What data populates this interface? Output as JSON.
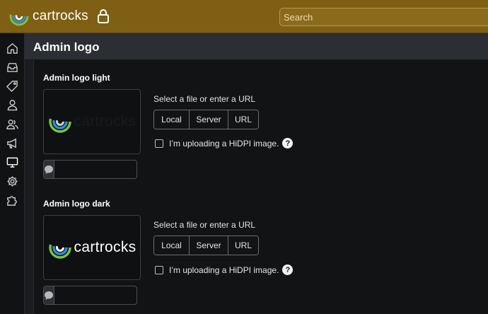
{
  "topbar": {
    "brand_name": "cartrocks",
    "lock_icon": "lock-icon",
    "search_placeholder": "Search"
  },
  "sidebar": {
    "items": [
      {
        "name": "home",
        "icon": "home-icon"
      },
      {
        "name": "inbox",
        "icon": "inbox-icon"
      },
      {
        "name": "tags",
        "icon": "tag-icon"
      },
      {
        "name": "user",
        "icon": "user-icon"
      },
      {
        "name": "users",
        "icon": "users-icon"
      },
      {
        "name": "announcements",
        "icon": "megaphone-icon"
      },
      {
        "name": "appearance",
        "icon": "monitor-icon",
        "active": true
      },
      {
        "name": "settings",
        "icon": "gear-icon"
      },
      {
        "name": "plugins",
        "icon": "puzzle-icon"
      }
    ]
  },
  "page": {
    "title": "Admin logo"
  },
  "sections": [
    {
      "title": "Admin logo light",
      "preview_text": "cartrocks",
      "preview_text_color": "#1a1a1a",
      "select_label": "Select a file or enter a URL",
      "buttons": [
        "Local",
        "Server",
        "URL"
      ],
      "hidpi_label": "I’m uploading a HiDPI image.",
      "help_label": "?"
    },
    {
      "title": "Admin logo dark",
      "preview_text": "cartrocks",
      "preview_text_color": "#ffffff",
      "select_label": "Select a file or enter a URL",
      "buttons": [
        "Local",
        "Server",
        "URL"
      ],
      "hidpi_label": "I’m uploading a HiDPI image.",
      "help_label": "?"
    }
  ],
  "colors": {
    "topbar_bg": "#7e5f13",
    "content_bg": "#111315",
    "header_bg": "#2b2e33"
  }
}
